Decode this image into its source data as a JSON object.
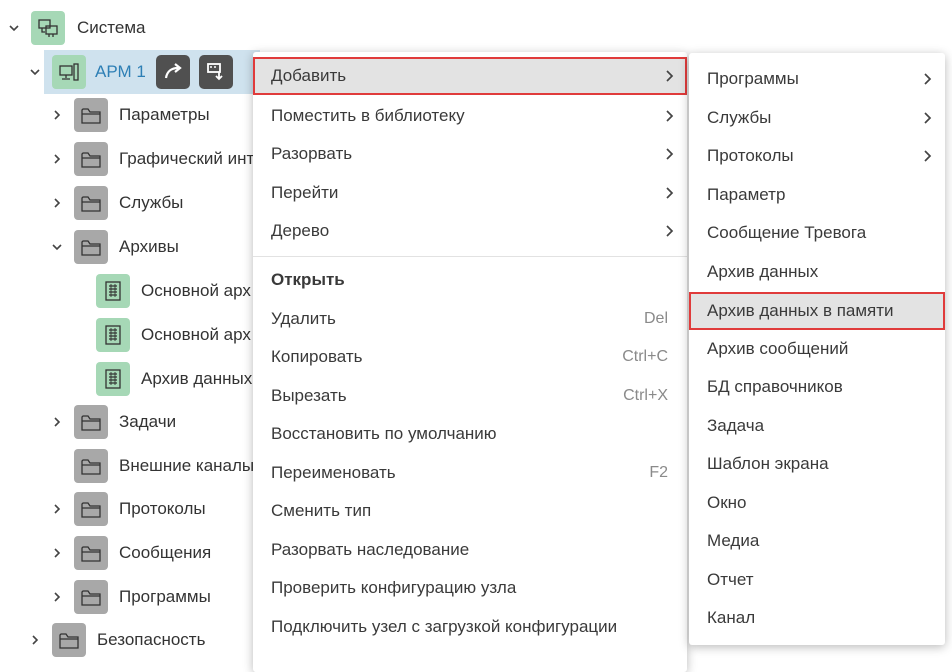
{
  "tree": {
    "system": {
      "label": "Система",
      "icon": "computer-network-icon"
    },
    "arm": {
      "label": "АРМ 1",
      "icon": "workstation-icon",
      "actions": [
        "redirect-arrow-icon",
        "drop-down-panel-icon"
      ]
    },
    "children": [
      {
        "label": "Параметры",
        "icon": "folder-icon"
      },
      {
        "label": "Графический инт",
        "icon": "folder-icon"
      },
      {
        "label": "Службы",
        "icon": "folder-icon"
      },
      {
        "label": "Архивы",
        "icon": "folder-icon"
      },
      {
        "label": "Основной арх",
        "icon": "archive-icon"
      },
      {
        "label": "Основной арх",
        "icon": "archive-icon"
      },
      {
        "label": "Архив данных",
        "icon": "archive-icon"
      },
      {
        "label": "Задачи",
        "icon": "folder-icon"
      },
      {
        "label": "Внешние каналы",
        "icon": "folder-icon"
      },
      {
        "label": "Протоколы",
        "icon": "folder-icon"
      },
      {
        "label": "Сообщения",
        "icon": "folder-icon"
      },
      {
        "label": "Программы",
        "icon": "folder-icon"
      }
    ],
    "security": {
      "label": "Безопасность",
      "icon": "folder-icon"
    }
  },
  "context_menu": {
    "items": [
      {
        "label": "Добавить",
        "submenu": true
      },
      {
        "label": "Поместить в библиотеку",
        "submenu": true
      },
      {
        "label": "Разорвать",
        "submenu": true
      },
      {
        "label": "Перейти",
        "submenu": true
      },
      {
        "label": "Дерево",
        "submenu": true
      },
      {
        "label": "Открыть"
      },
      {
        "label": "Удалить",
        "shortcut": "Del"
      },
      {
        "label": "Копировать",
        "shortcut": "Ctrl+C"
      },
      {
        "label": "Вырезать",
        "shortcut": "Ctrl+X"
      },
      {
        "label": "Восстановить по умолчанию"
      },
      {
        "label": "Переименовать",
        "shortcut": "F2"
      },
      {
        "label": "Сменить тип"
      },
      {
        "label": "Разорвать наследование"
      },
      {
        "label": "Проверить конфигурацию узла"
      },
      {
        "label": "Подключить узел с загрузкой конфигурации"
      }
    ]
  },
  "submenu": {
    "items": [
      {
        "label": "Программы",
        "submenu": true
      },
      {
        "label": "Службы",
        "submenu": true
      },
      {
        "label": "Протоколы",
        "submenu": true
      },
      {
        "label": "Параметр"
      },
      {
        "label": "Сообщение Тревога"
      },
      {
        "label": "Архив данных"
      },
      {
        "label": "Архив данных в памяти"
      },
      {
        "label": "Архив сообщений"
      },
      {
        "label": "БД справочников"
      },
      {
        "label": "Задача"
      },
      {
        "label": "Шаблон экрана"
      },
      {
        "label": "Окно"
      },
      {
        "label": "Медиа"
      },
      {
        "label": "Отчет"
      },
      {
        "label": "Канал"
      }
    ]
  },
  "colors": {
    "selected_row": "#cfe2ee",
    "highlight_box": "#e03b3b",
    "tree_link": "#2d7fb5",
    "icon_green": "#a6d8b6",
    "icon_gray": "#a8a8a8"
  }
}
